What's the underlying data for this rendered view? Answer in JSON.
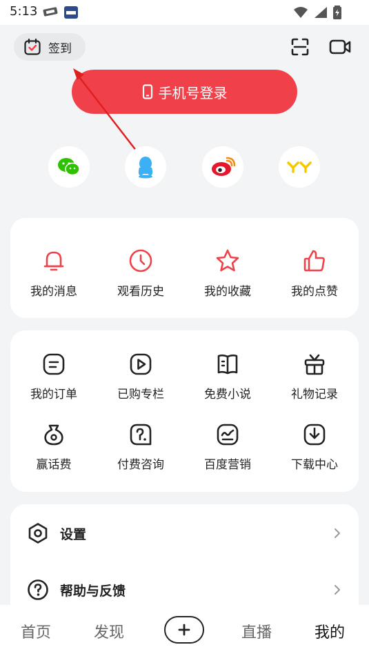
{
  "status_bar": {
    "time": "5:13"
  },
  "header": {
    "checkin_label": "签到"
  },
  "login": {
    "label": "手机号登录"
  },
  "social": [
    "wechat-icon",
    "qq-icon",
    "weibo-icon",
    "yy-icon"
  ],
  "quick_actions": [
    {
      "label": "我的消息",
      "icon": "bell-icon"
    },
    {
      "label": "观看历史",
      "icon": "clock-icon"
    },
    {
      "label": "我的收藏",
      "icon": "star-icon"
    },
    {
      "label": "我的点赞",
      "icon": "thumbs-up-icon"
    }
  ],
  "services": [
    {
      "label": "我的订单",
      "icon": "order-icon"
    },
    {
      "label": "已购专栏",
      "icon": "play-icon"
    },
    {
      "label": "免费小说",
      "icon": "book-icon"
    },
    {
      "label": "礼物记录",
      "icon": "gift-icon"
    },
    {
      "label": "赢话费",
      "icon": "money-bag-icon"
    },
    {
      "label": "付费咨询",
      "icon": "consult-icon"
    },
    {
      "label": "百度营销",
      "icon": "marketing-icon"
    },
    {
      "label": "下载中心",
      "icon": "download-icon"
    }
  ],
  "menu": [
    {
      "label": "设置",
      "icon": "settings-icon"
    },
    {
      "label": "帮助与反馈",
      "icon": "help-icon"
    }
  ],
  "tabbar": {
    "home": "首页",
    "discover": "发现",
    "live": "直播",
    "mine": "我的"
  },
  "colors": {
    "accent": "#f0414a",
    "wechat": "#2dc100",
    "qq": "#3cb0f4",
    "weibo": "#e6162d",
    "yy": "#f5c800"
  }
}
